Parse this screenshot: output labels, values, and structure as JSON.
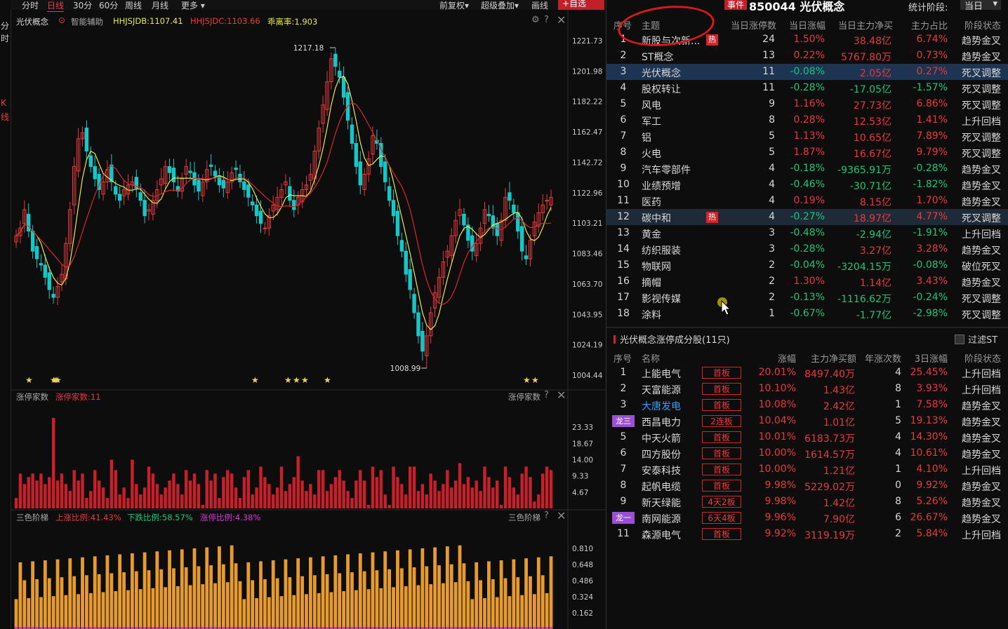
{
  "left_strip": [
    "分",
    "时",
    "K",
    "线"
  ],
  "toolbar": {
    "tabs": [
      "分时",
      "日线",
      "30分",
      "60分",
      "周线",
      "月线",
      "更多 ▾"
    ],
    "active_tab": "日线",
    "right_items": [
      "前复权▾",
      "超级叠加▾",
      "画线"
    ],
    "add_fav": "+自选"
  },
  "header": {
    "event_tag": "事件",
    "title": "850044 光伏概念",
    "stat_label": "统计阶段:",
    "stat_value": "当日"
  },
  "main_chart": {
    "name": "光伏概念",
    "assist": "智能辅助",
    "ind1": "HHJSJDB:1107.41",
    "ind2": "HHJSJDC:1103.66",
    "ind3": "乖离率:1.903",
    "high_label": "1217.18",
    "low_label": "1008.99",
    "y_ticks": [
      "1221.73",
      "1201.98",
      "1182.22",
      "1162.47",
      "1142.72",
      "1122.96",
      "1103.21",
      "1083.46",
      "1063.70",
      "1043.95",
      "1024.19",
      "1004.44"
    ]
  },
  "limit_panel": {
    "name": "涨停家数",
    "value": "涨停家数:11",
    "right_name": "涨停家数",
    "y_ticks": [
      "23.33",
      "18.67",
      "14.00",
      "9.33",
      "4.67"
    ]
  },
  "tri_panel": {
    "name": "三色阶梯",
    "up": "上涨比例:41.43%",
    "down": "下跌比例:58.57%",
    "limit": "涨停比例:4.38%",
    "right_name": "三色阶梯",
    "y_ticks": [
      "0.810",
      "0.648",
      "0.486",
      "0.324",
      "0.162"
    ]
  },
  "colors": {
    "up": "#e8393b",
    "down": "#16c7c7",
    "ma5": "#e8e84a",
    "ma10": "#d42a2a",
    "bar_red": "#c8202a",
    "bar_orange": "#e79a2e"
  },
  "theme_table": {
    "headers": [
      "序号",
      "主题",
      "当日涨停数",
      "当日涨幅",
      "当日主力净买",
      "主力占比",
      "阶段状态"
    ],
    "rows": [
      {
        "no": "1",
        "name": "新股与次新...",
        "hot": "热",
        "cnt": "24",
        "chg": "1.50%",
        "net": "38.48亿",
        "pct": "6.74%",
        "state": "趋势金叉"
      },
      {
        "no": "2",
        "name": "ST概念",
        "hot": "",
        "cnt": "13",
        "chg": "0.22%",
        "net": "5767.80万",
        "pct": "0.73%",
        "state": "趋势金叉"
      },
      {
        "no": "3",
        "name": "光伏概念",
        "hot": "",
        "cnt": "11",
        "chg": "-0.08%",
        "net": "2.05亿",
        "pct": "0.27%",
        "state": "死叉调整"
      },
      {
        "no": "4",
        "name": "股权转让",
        "hot": "",
        "cnt": "11",
        "chg": "-0.28%",
        "net": "-17.05亿",
        "pct": "-1.57%",
        "state": "死叉调整"
      },
      {
        "no": "5",
        "name": "风电",
        "hot": "",
        "cnt": "9",
        "chg": "1.16%",
        "net": "27.73亿",
        "pct": "6.86%",
        "state": "死叉调整"
      },
      {
        "no": "6",
        "name": "军工",
        "hot": "",
        "cnt": "8",
        "chg": "0.28%",
        "net": "12.53亿",
        "pct": "1.41%",
        "state": "上升回档"
      },
      {
        "no": "7",
        "name": "铝",
        "hot": "",
        "cnt": "5",
        "chg": "1.13%",
        "net": "10.65亿",
        "pct": "7.89%",
        "state": "死叉调整"
      },
      {
        "no": "8",
        "name": "火电",
        "hot": "",
        "cnt": "5",
        "chg": "1.87%",
        "net": "16.67亿",
        "pct": "9.79%",
        "state": "死叉调整"
      },
      {
        "no": "9",
        "name": "汽车零部件",
        "hot": "",
        "cnt": "4",
        "chg": "-0.18%",
        "net": "-9365.91万",
        "pct": "-0.28%",
        "state": "趋势金叉"
      },
      {
        "no": "10",
        "name": "业绩预增",
        "hot": "",
        "cnt": "4",
        "chg": "-0.46%",
        "net": "-30.71亿",
        "pct": "-1.82%",
        "state": "趋势金叉"
      },
      {
        "no": "11",
        "name": "医药",
        "hot": "",
        "cnt": "4",
        "chg": "0.19%",
        "net": "8.15亿",
        "pct": "1.70%",
        "state": "趋势金叉"
      },
      {
        "no": "12",
        "name": "碳中和",
        "hot": "热",
        "cnt": "4",
        "chg": "-0.27%",
        "net": "18.97亿",
        "pct": "4.77%",
        "state": "死叉调整"
      },
      {
        "no": "13",
        "name": "黄金",
        "hot": "",
        "cnt": "3",
        "chg": "-0.48%",
        "net": "-2.94亿",
        "pct": "-1.91%",
        "state": "上升回档"
      },
      {
        "no": "14",
        "name": "纺织服装",
        "hot": "",
        "cnt": "3",
        "chg": "-0.28%",
        "net": "3.27亿",
        "pct": "3.28%",
        "state": "趋势金叉"
      },
      {
        "no": "15",
        "name": "物联网",
        "hot": "",
        "cnt": "2",
        "chg": "-0.04%",
        "net": "-3204.15万",
        "pct": "-0.08%",
        "state": "破位死叉"
      },
      {
        "no": "16",
        "name": "摘帽",
        "hot": "",
        "cnt": "2",
        "chg": "1.30%",
        "net": "1.14亿",
        "pct": "3.43%",
        "state": "趋势金叉"
      },
      {
        "no": "17",
        "name": "影视传媒",
        "hot": "",
        "cnt": "2",
        "chg": "-0.13%",
        "net": "-1116.62万",
        "pct": "-0.24%",
        "state": "死叉调整"
      },
      {
        "no": "18",
        "name": "涂料",
        "hot": "",
        "cnt": "1",
        "chg": "-0.67%",
        "net": "-1.77亿",
        "pct": "-2.98%",
        "state": "死叉调整"
      }
    ]
  },
  "stock_section": {
    "title": "光伏概念涨停成分股(11只)",
    "filter": "过滤ST",
    "headers": [
      "序号",
      "名称",
      "涨幅",
      "主力净买额",
      "年涨次数",
      "3日涨幅",
      "阶段状态"
    ],
    "rows": [
      {
        "no": "1",
        "tag": "",
        "name": "上能电气",
        "blue": false,
        "badge": "首板",
        "chg": "20.01%",
        "net": "8497.40万",
        "yc": "4",
        "d3": "25.45%",
        "state": "上升回档"
      },
      {
        "no": "2",
        "tag": "",
        "name": "天富能源",
        "blue": false,
        "badge": "首板",
        "chg": "10.10%",
        "net": "1.43亿",
        "yc": "8",
        "d3": "3.93%",
        "state": "上升回档"
      },
      {
        "no": "3",
        "tag": "",
        "name": "大唐发电",
        "blue": true,
        "badge": "首板",
        "chg": "10.08%",
        "net": "2.42亿",
        "yc": "1",
        "d3": "7.58%",
        "state": "趋势金叉"
      },
      {
        "no": "",
        "tag": "龙三",
        "name": "西昌电力",
        "blue": false,
        "badge": "2连板",
        "chg": "10.04%",
        "net": "1.01亿",
        "yc": "5",
        "d3": "19.13%",
        "state": "趋势金叉"
      },
      {
        "no": "5",
        "tag": "",
        "name": "中天火箭",
        "blue": false,
        "badge": "首板",
        "chg": "10.01%",
        "net": "6183.73万",
        "yc": "4",
        "d3": "14.30%",
        "state": "趋势金叉"
      },
      {
        "no": "6",
        "tag": "",
        "name": "四方股份",
        "blue": false,
        "badge": "首板",
        "chg": "10.00%",
        "net": "1614.57万",
        "yc": "4",
        "d3": "10.61%",
        "state": "趋势金叉"
      },
      {
        "no": "7",
        "tag": "",
        "name": "安泰科技",
        "blue": false,
        "badge": "首板",
        "chg": "10.00%",
        "net": "1.21亿",
        "yc": "1",
        "d3": "4.10%",
        "state": "上升回档"
      },
      {
        "no": "8",
        "tag": "",
        "name": "起帆电缆",
        "blue": false,
        "badge": "首板",
        "chg": "9.98%",
        "net": "5229.02万",
        "yc": "0",
        "d3": "9.92%",
        "state": "趋势金叉"
      },
      {
        "no": "9",
        "tag": "",
        "name": "新天绿能",
        "blue": false,
        "badge": "4天2板",
        "chg": "9.98%",
        "net": "1.42亿",
        "yc": "8",
        "d3": "5.26%",
        "state": "趋势金叉"
      },
      {
        "no": "",
        "tag": "龙一",
        "name": "南网能源",
        "blue": false,
        "badge": "6天4板",
        "chg": "9.96%",
        "net": "7.90亿",
        "yc": "6",
        "d3": "26.67%",
        "state": "趋势金叉"
      },
      {
        "no": "11",
        "tag": "",
        "name": "森源电气",
        "blue": false,
        "badge": "首板",
        "chg": "9.92%",
        "net": "3119.19万",
        "yc": "2",
        "d3": "5.84%",
        "state": "上升回档"
      }
    ]
  }
}
